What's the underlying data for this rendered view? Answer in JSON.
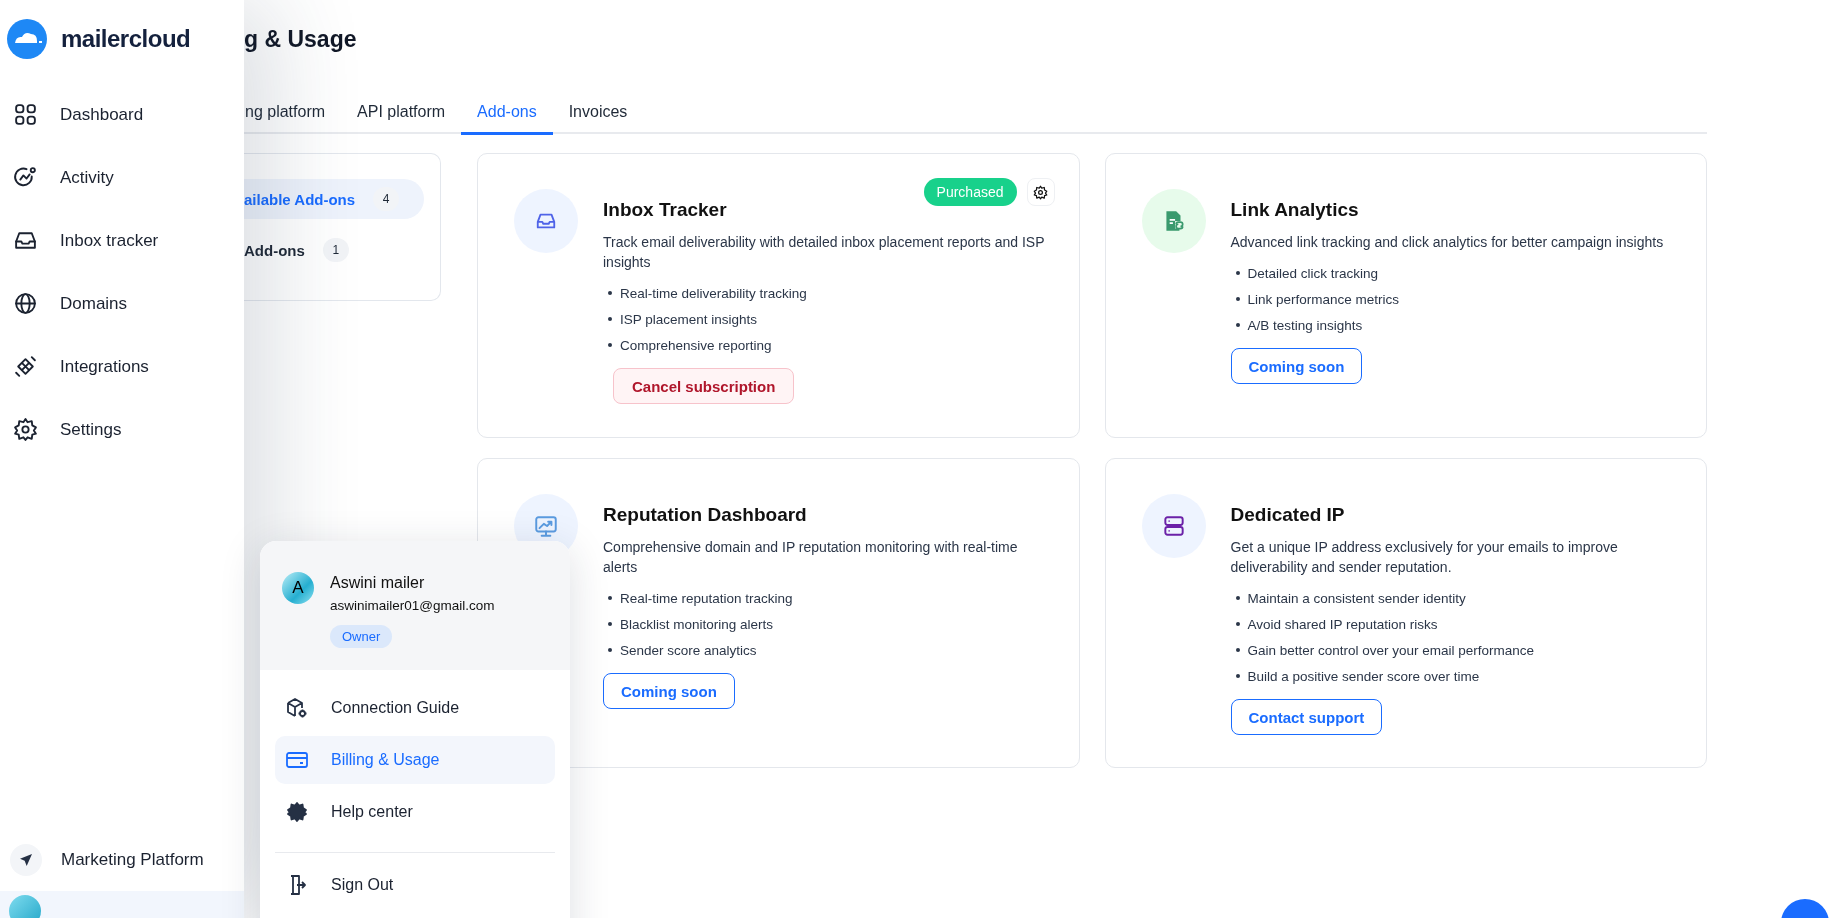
{
  "brand": {
    "name": "mailercloud"
  },
  "nav": [
    {
      "label": "Dashboard"
    },
    {
      "label": "Activity"
    },
    {
      "label": "Inbox tracker"
    },
    {
      "label": "Domains"
    },
    {
      "label": "Integrations"
    },
    {
      "label": "Settings"
    }
  ],
  "nav_bottom": [
    {
      "label": "Marketing Platform"
    }
  ],
  "page": {
    "title": "g & Usage"
  },
  "tabs": [
    {
      "label": "ng platform",
      "selected": false
    },
    {
      "label": "API platform",
      "selected": false
    },
    {
      "label": "Add-ons",
      "selected": true
    },
    {
      "label": "Invoices",
      "selected": false
    }
  ],
  "addon_filters": [
    {
      "label": "ailable Add-ons",
      "count": "4",
      "selected": true
    },
    {
      "label": "Add-ons",
      "count": "1",
      "selected": false
    }
  ],
  "addons": [
    {
      "title": "Inbox Tracker",
      "description": "Track email deliverability with detailed inbox placement reports and ISP insights",
      "features": [
        "Real-time deliverability tracking",
        "ISP placement insights",
        "Comprehensive reporting"
      ],
      "purchased": true,
      "badge": "Purchased",
      "action": {
        "label": "Cancel subscription",
        "kind": "danger"
      }
    },
    {
      "title": "Link Analytics",
      "description": "Advanced link tracking and click analytics for better campaign insights",
      "features": [
        "Detailed click tracking",
        "Link performance metrics",
        "A/B testing insights"
      ],
      "purchased": false,
      "action": {
        "label": "Coming soon",
        "kind": "outline"
      }
    },
    {
      "title": "Reputation Dashboard",
      "description": "Comprehensive domain and IP reputation monitoring with real-time alerts",
      "features": [
        "Real-time reputation tracking",
        "Blacklist monitoring alerts",
        "Sender score analytics"
      ],
      "purchased": false,
      "action": {
        "label": "Coming soon",
        "kind": "outline"
      }
    },
    {
      "title": "Dedicated IP",
      "description": "Get a unique IP address exclusively for your emails to improve deliverability and sender reputation.",
      "features": [
        "Maintain a consistent sender identity",
        "Avoid shared IP reputation risks",
        "Gain better control over your email performance",
        "Build a positive sender score over time"
      ],
      "purchased": false,
      "action": {
        "label": "Contact support",
        "kind": "outline"
      }
    }
  ],
  "user_menu": {
    "initial": "A",
    "name": "Aswini mailer",
    "email": "aswinimailer01@gmail.com",
    "role": "Owner",
    "items": [
      {
        "label": "Connection Guide",
        "selected": false
      },
      {
        "label": "Billing & Usage",
        "selected": true
      },
      {
        "label": "Help center",
        "selected": false
      }
    ],
    "sign_out": "Sign Out"
  }
}
